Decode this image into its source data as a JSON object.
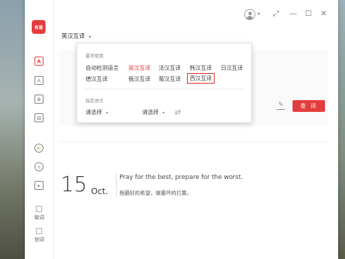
{
  "app": {
    "logo_text": "有道"
  },
  "titlebar": {
    "avatar_caret": "▾",
    "pin_icon": "⤢",
    "minimize_icon": "—",
    "maximize_icon": "☐",
    "close_icon": "✕"
  },
  "sidebar": {
    "items": [
      {
        "icon": "A"
      },
      {
        "icon": "A"
      },
      {
        "icon": "≣"
      },
      {
        "icon": "▤"
      },
      {
        "icon": "⛅"
      },
      {
        "icon": "∩"
      },
      {
        "icon": "▸"
      }
    ],
    "bottom": [
      {
        "label": "取词"
      },
      {
        "label": "划词"
      }
    ]
  },
  "lang_select": {
    "value": "英汉互译",
    "caret": "▾"
  },
  "dropdown": {
    "common_label": "最常使用",
    "items_row1": [
      "自动检测语言",
      "英汉互译",
      "法汉互译",
      "韩汉互译",
      "日汉互译"
    ],
    "items_row2": [
      "德汉互译",
      "俄汉互译",
      "葡汉互译",
      "西汉互译"
    ],
    "specify_label": "指定语言",
    "select_from": "请选择",
    "select_to": "请选择",
    "caret": "▾",
    "swap_icon": "⇄"
  },
  "content": {
    "query_button": "查 词",
    "edit_icon": "✎"
  },
  "daily": {
    "day": "15",
    "month": "Oct.",
    "quote_en": "Pray for the best, prepare for the worst.",
    "quote_zh": "抱最好的希望，做最坏的打算。"
  },
  "colors": {
    "accent": "#e43d3d",
    "highlight_box": "#d62020"
  }
}
